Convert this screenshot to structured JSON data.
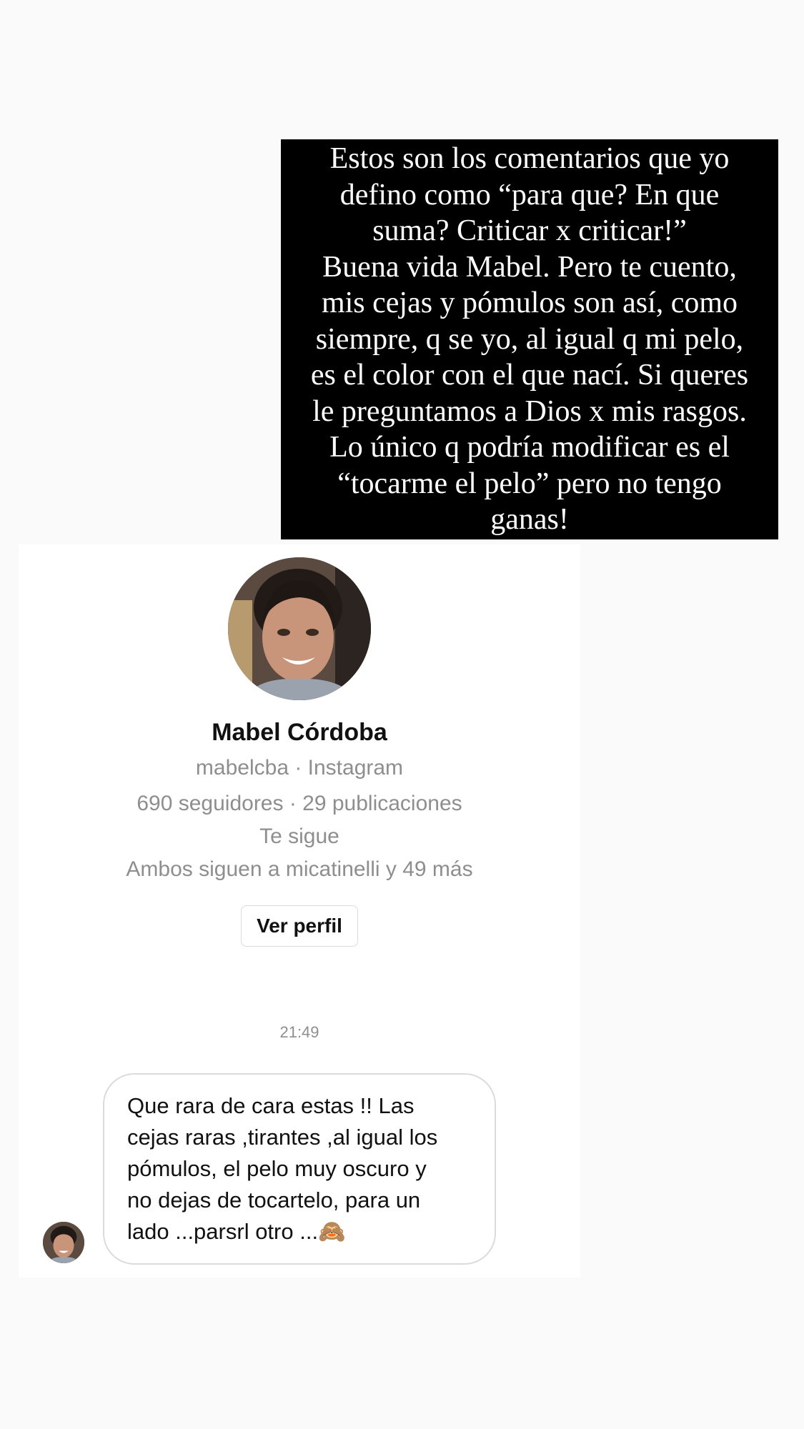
{
  "story_caption": {
    "text": "Estos son los comentarios que yo\ndefino como “para que? En que\nsuma? Criticar x criticar!”\nBuena vida Mabel. Pero te cuento,\nmis cejas y pómulos son así, como\nsiempre, q se yo, al igual q mi pelo,\nes el color con el que nací. Si queres\nle preguntamos a Dios x mis rasgos.\nLo único q podría modificar es el\n“tocarme el pelo” pero no tengo\nganas!"
  },
  "profile": {
    "name": "Mabel Córdoba",
    "handle_line": "mabelcba · Instagram",
    "stats_line": "690 seguidores · 29 publicaciones",
    "follows_you": "Te sigue",
    "mutual_line": "Ambos siguen a micatinelli y 49 más",
    "view_profile_label": "Ver perfil"
  },
  "thread": {
    "timestamp": "21:49",
    "message": {
      "text": "Que rara de cara estas !! Las\ncejas raras ,tirantes ,al igual los\npómulos,  el pelo muy oscuro y\nno dejas de tocartelo, para un\nlado ...parsrl otro ...",
      "emoji": "🙈"
    }
  },
  "colors": {
    "caption_background": "#000000",
    "caption_text": "#ffffff",
    "page_background": "#fafafa",
    "card_background": "#ffffff",
    "secondary_text": "#8e8e8e",
    "bubble_border": "#dbdbdb"
  },
  "icons": {
    "profile_photo": "avatar-photo",
    "sender_photo": "avatar-photo"
  }
}
